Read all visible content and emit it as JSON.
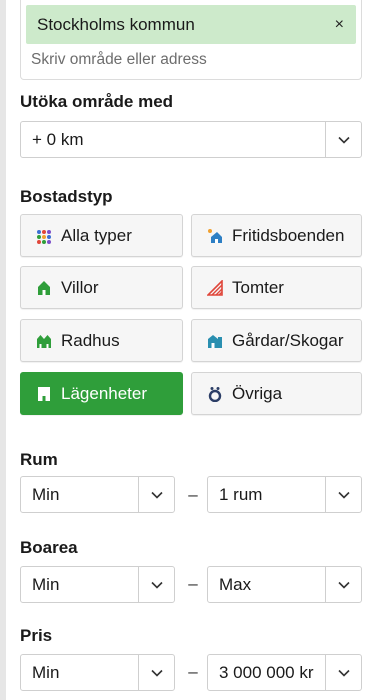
{
  "area": {
    "chip_label": "Stockholms kommun",
    "chip_close": "×",
    "placeholder": "Skriv område eller adress"
  },
  "expand": {
    "title": "Utöka område med",
    "value": "+ 0 km"
  },
  "housing": {
    "title": "Bostadstyp",
    "types": [
      {
        "label": "Alla typer",
        "icon": "grid-dots-icon",
        "active": false
      },
      {
        "label": "Fritidsboenden",
        "icon": "vacation-home-icon",
        "active": false
      },
      {
        "label": "Villor",
        "icon": "house-icon",
        "active": false
      },
      {
        "label": "Tomter",
        "icon": "plot-icon",
        "active": false
      },
      {
        "label": "Radhus",
        "icon": "row-house-icon",
        "active": false
      },
      {
        "label": "Gårdar/Skogar",
        "icon": "farm-icon",
        "active": false
      },
      {
        "label": "Lägenheter",
        "icon": "apartment-icon",
        "active": true
      },
      {
        "label": "Övriga",
        "icon": "other-icon",
        "active": false
      }
    ]
  },
  "rooms": {
    "title": "Rum",
    "min": "Min",
    "max": "1 rum",
    "separator": "–"
  },
  "area_size": {
    "title": "Boarea",
    "min": "Min",
    "max": "Max",
    "separator": "–"
  },
  "price": {
    "title": "Pris",
    "min": "Min",
    "max": "3 000 000 kr",
    "separator": "–"
  },
  "colors": {
    "accent": "#2f9e3a",
    "chip_bg": "#cdeacb"
  }
}
